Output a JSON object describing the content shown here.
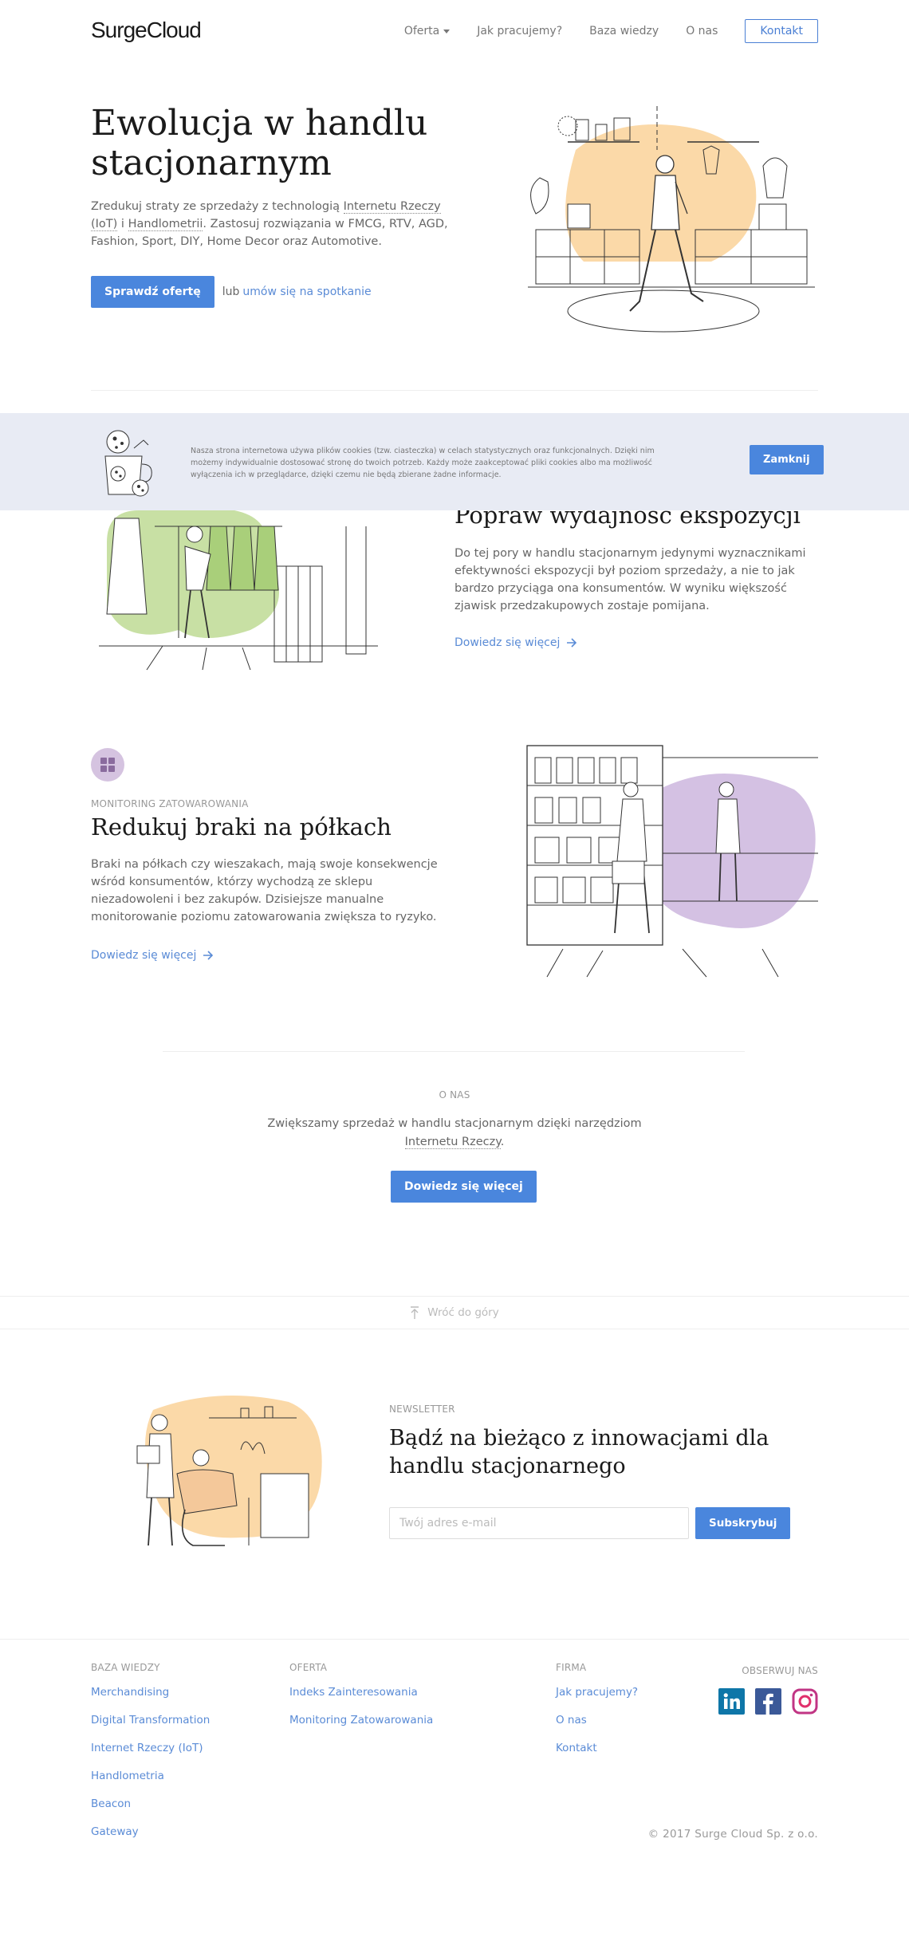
{
  "brand": {
    "logo": "SurgeCloud",
    "accent": "#4a86dd"
  },
  "nav": {
    "items": [
      "Oferta",
      "Jak pracujemy?",
      "Baza wiedzy",
      "O nas"
    ],
    "contact": "Kontakt"
  },
  "hero": {
    "title": "Ewolucja w handlu stacjonarnym",
    "text_1": "Zredukuj straty ze sprzedaży z technologią ",
    "link_iot": "Internetu Rzeczy (IoT)",
    "text_2": " i ",
    "link_handlometria": "Handlometrii",
    "text_3": ". Zastosuj rozwiązania w FMCG, RTV, AGD, Fashion, Sport, DIY, Home Decor oraz Automotive.",
    "cta": "Sprawdź ofertę",
    "or": "lub",
    "meeting_link": "umów się na spotkanie"
  },
  "cookie": {
    "text": "Nasza strona internetowa używa plików cookies (tzw. ciasteczka) w celach statystycznych oraz funkcjonalnych. Dzięki nim możemy indywidualnie dostosować stronę do twoich potrzeb. Każdy może zaakceptować pliki cookies albo ma możliwość wyłączenia ich w przeglądarce, dzięki czemu nie będą zbierane żadne informacje.",
    "close": "Zamknij"
  },
  "section1": {
    "title": "Popraw wydajność ekspozycji",
    "text": "Do tej pory w handlu stacjonarnym jedynymi wyznacznikami efektywności ekspozycji był poziom sprzedaży, a nie to jak bardzo przyciąga ona konsumentów. W wyniku większość zjawisk przedzakupowych zostaje pomijana.",
    "more": "Dowiedz się więcej"
  },
  "section2": {
    "eyebrow": "MONITORING ZATOWAROWANIA",
    "title": "Redukuj braki na półkach",
    "text": "Braki na półkach czy wieszakach, mają swoje konsekwencje wśród konsumentów, którzy wychodzą ze sklepu niezadowoleni i bez zakupów. Dzisiejsze manualne monitorowanie poziomu zatowarowania zwiększa to ryzyko.",
    "more": "Dowiedz się więcej"
  },
  "about": {
    "eyebrow": "O NAS",
    "text_1": "Zwiększamy sprzedaż w handlu stacjonarnym dzięki narzędziom ",
    "link": "Internetu Rzeczy",
    "text_2": ".",
    "cta": "Dowiedz się więcej"
  },
  "back_to_top": "Wróć do góry",
  "newsletter": {
    "eyebrow": "NEWSLETTER",
    "title": "Bądź na bieżąco z innowacjami dla handlu stacjonarnego",
    "placeholder": "Twój adres e-mail",
    "button": "Subskrybuj"
  },
  "footer": {
    "col1": {
      "title": "BAZA WIEDZY",
      "items": [
        "Merchandising",
        "Digital Transformation",
        "Internet Rzeczy (IoT)",
        "Handlometria",
        "Beacon",
        "Gateway"
      ]
    },
    "col2": {
      "title": "OFERTA",
      "items": [
        "Indeks Zainteresowania",
        "Monitoring Zatowarowania"
      ]
    },
    "col3": {
      "title": "FIRMA",
      "items": [
        "Jak pracujemy?",
        "O nas",
        "Kontakt"
      ]
    },
    "social_title": "OBSERWUJ NAS",
    "social": [
      "linkedin-icon",
      "facebook-icon",
      "instagram-icon"
    ],
    "copyright": "© 2017 Surge Cloud Sp. z o.o."
  }
}
